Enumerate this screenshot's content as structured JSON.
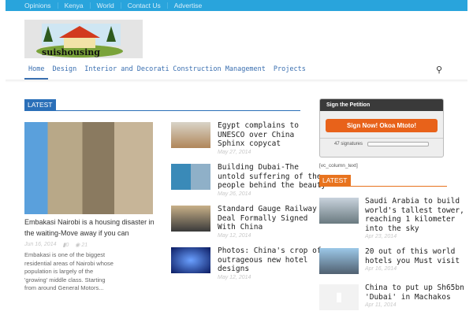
{
  "topnav": [
    "Opinions",
    "Kenya",
    "World",
    "Contact Us",
    "Advertise"
  ],
  "logo_text": "suishousing",
  "nav": [
    {
      "label": "Home"
    },
    {
      "label": "Design"
    },
    {
      "label": "Interior and Decoration"
    },
    {
      "label": "Construction Management"
    },
    {
      "label": "Projects"
    }
  ],
  "latest_label": "LATEST",
  "featured": {
    "title": "Embakasi Nairobi is a housing disaster in the waiting-Move away if you can",
    "date": "Jun 16, 2014",
    "comments": "0",
    "views": "21",
    "excerpt": "Embakasi is one of the biggest residential areas of Nairobi whose population is largely of the 'growing' middle class. Starting from around General Motors..."
  },
  "posts": [
    {
      "title": "Egypt complains to UNESCO over China Sphinx copycat",
      "date": "May 27, 2014"
    },
    {
      "title": "Building Dubai-The untold suffering of the people behind the beauty",
      "date": "May 26, 2014"
    },
    {
      "title": "Standard Gauge Railway Deal Formally Signed With China",
      "date": "May 12, 2014"
    },
    {
      "title": "Photos: China's crop of outrageous new hotel designs",
      "date": "May 12, 2014"
    }
  ],
  "petition": {
    "title": "Sign the Petition",
    "button": "Sign Now! Okoa Mtoto!",
    "signatures": "47 signatures",
    "progress": 0
  },
  "shortcode": "[vc_column_text]",
  "side_label": "LATEST",
  "side_posts": [
    {
      "title": "Saudi Arabia to build world's tallest tower, reaching 1 kilometer into the sky",
      "date": "Apr 23, 2014"
    },
    {
      "title": "20 out of this world hotels you Must visit",
      "date": "Apr 16, 2014"
    },
    {
      "title": "China to put up Sh65bn 'Dubai' in Machakos",
      "date": "Apr 11, 2014"
    }
  ],
  "colors": {
    "topbar": "#29a4dc",
    "accent": "#2a6fb8",
    "orange": "#e8731e"
  }
}
